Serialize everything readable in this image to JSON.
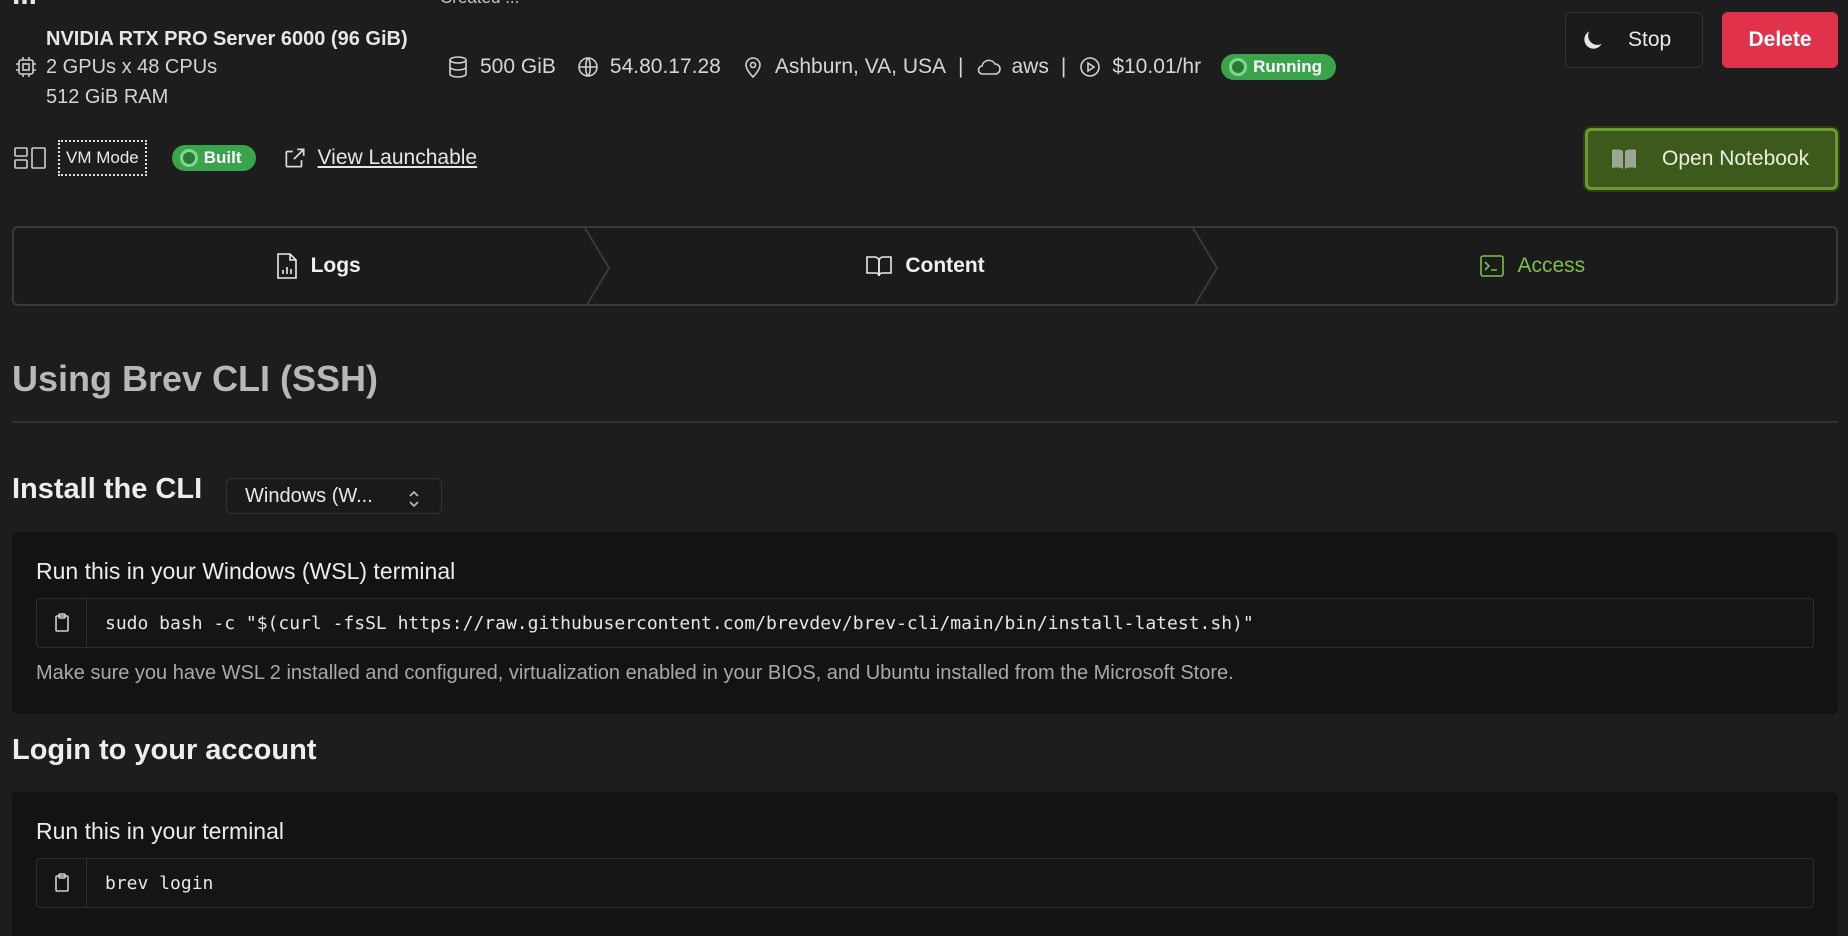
{
  "header": {
    "title_cut": "...",
    "created_cut": "Created ...",
    "gpu_name": "NVIDIA RTX PRO Server 6000 (96 GiB)",
    "gpu_config": "2 GPUs x 48 CPUs",
    "ram": "512 GiB RAM",
    "storage": "500 GiB",
    "ip": "54.80.17.28",
    "location": "Ashburn, VA, USA",
    "separator": "|",
    "provider": "aws",
    "price": "$10.01/hr",
    "status": "Running",
    "icons": [
      "chip-icon",
      "database-icon",
      "globe-icon",
      "location-pin-icon",
      "cloud-icon",
      "play-circle-icon",
      "moon-icon"
    ]
  },
  "actions": {
    "stop_label": "Stop",
    "delete_label": "Delete",
    "open_notebook_label": "Open Notebook"
  },
  "mode_row": {
    "vm_mode_label": "VM Mode",
    "build_status": "Built",
    "view_launchable_label": "View Launchable"
  },
  "steps": [
    {
      "label": "Logs",
      "icon": "file-chart-icon"
    },
    {
      "label": "Content",
      "icon": "book-open-icon"
    },
    {
      "label": "Access",
      "icon": "terminal-icon"
    }
  ],
  "section": {
    "title": "Using Brev CLI (SSH)"
  },
  "install": {
    "heading": "Install the CLI",
    "os_select": "Windows (W...",
    "card_title": "Run this in your Windows (WSL) terminal",
    "command": "sudo bash -c \"$(curl -fsSL https://raw.githubusercontent.com/brevdev/brev-cli/main/bin/install-latest.sh)\"",
    "note": "Make sure you have WSL 2 installed and configured, virtualization enabled in your BIOS, and Ubuntu installed from the Microsoft Store."
  },
  "login": {
    "heading": "Login to your account",
    "card_title": "Run this in your terminal",
    "command": "brev login"
  },
  "colors": {
    "background": "#1d1d1d",
    "running_green": "#3aa44c",
    "delete_red": "#e0324b",
    "notebook_green": "#3d5a1c",
    "access_green": "#7cc04a"
  }
}
